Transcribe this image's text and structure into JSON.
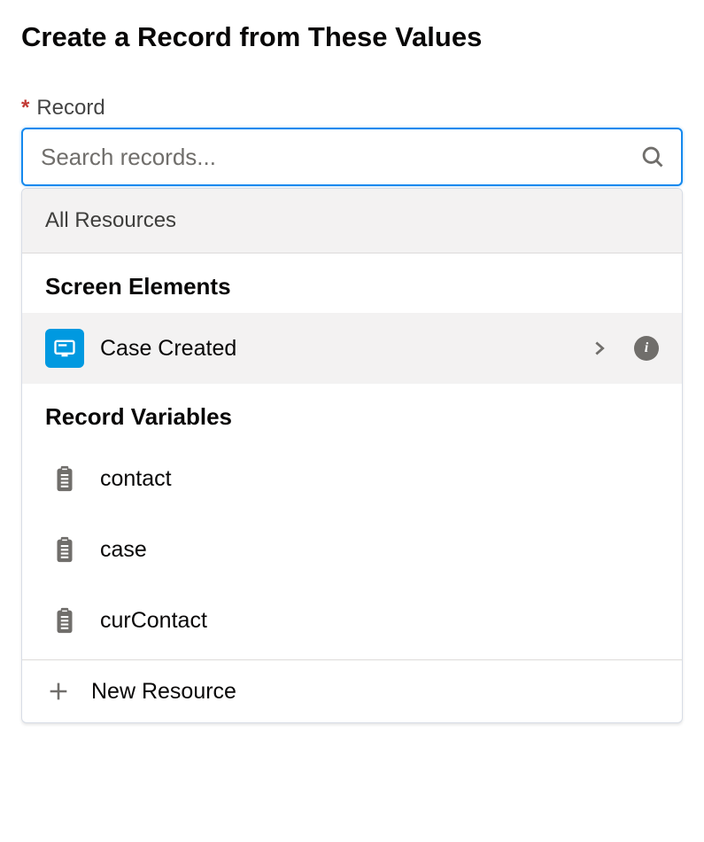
{
  "section": {
    "title": "Create a Record from These Values"
  },
  "field": {
    "required_indicator": "*",
    "label": "Record",
    "placeholder": "Search records..."
  },
  "dropdown": {
    "breadcrumb": "All Resources",
    "groups": [
      {
        "title": "Screen Elements",
        "items": [
          {
            "label": "Case Created",
            "iconType": "screen",
            "selected": true,
            "hasChildren": true
          }
        ]
      },
      {
        "title": "Record Variables",
        "items": [
          {
            "label": "contact",
            "iconType": "record",
            "selected": false,
            "hasChildren": false
          },
          {
            "label": "case",
            "iconType": "record",
            "selected": false,
            "hasChildren": false
          },
          {
            "label": "curContact",
            "iconType": "record",
            "selected": false,
            "hasChildren": false
          }
        ]
      }
    ],
    "newResource": {
      "label": "New Resource"
    }
  }
}
